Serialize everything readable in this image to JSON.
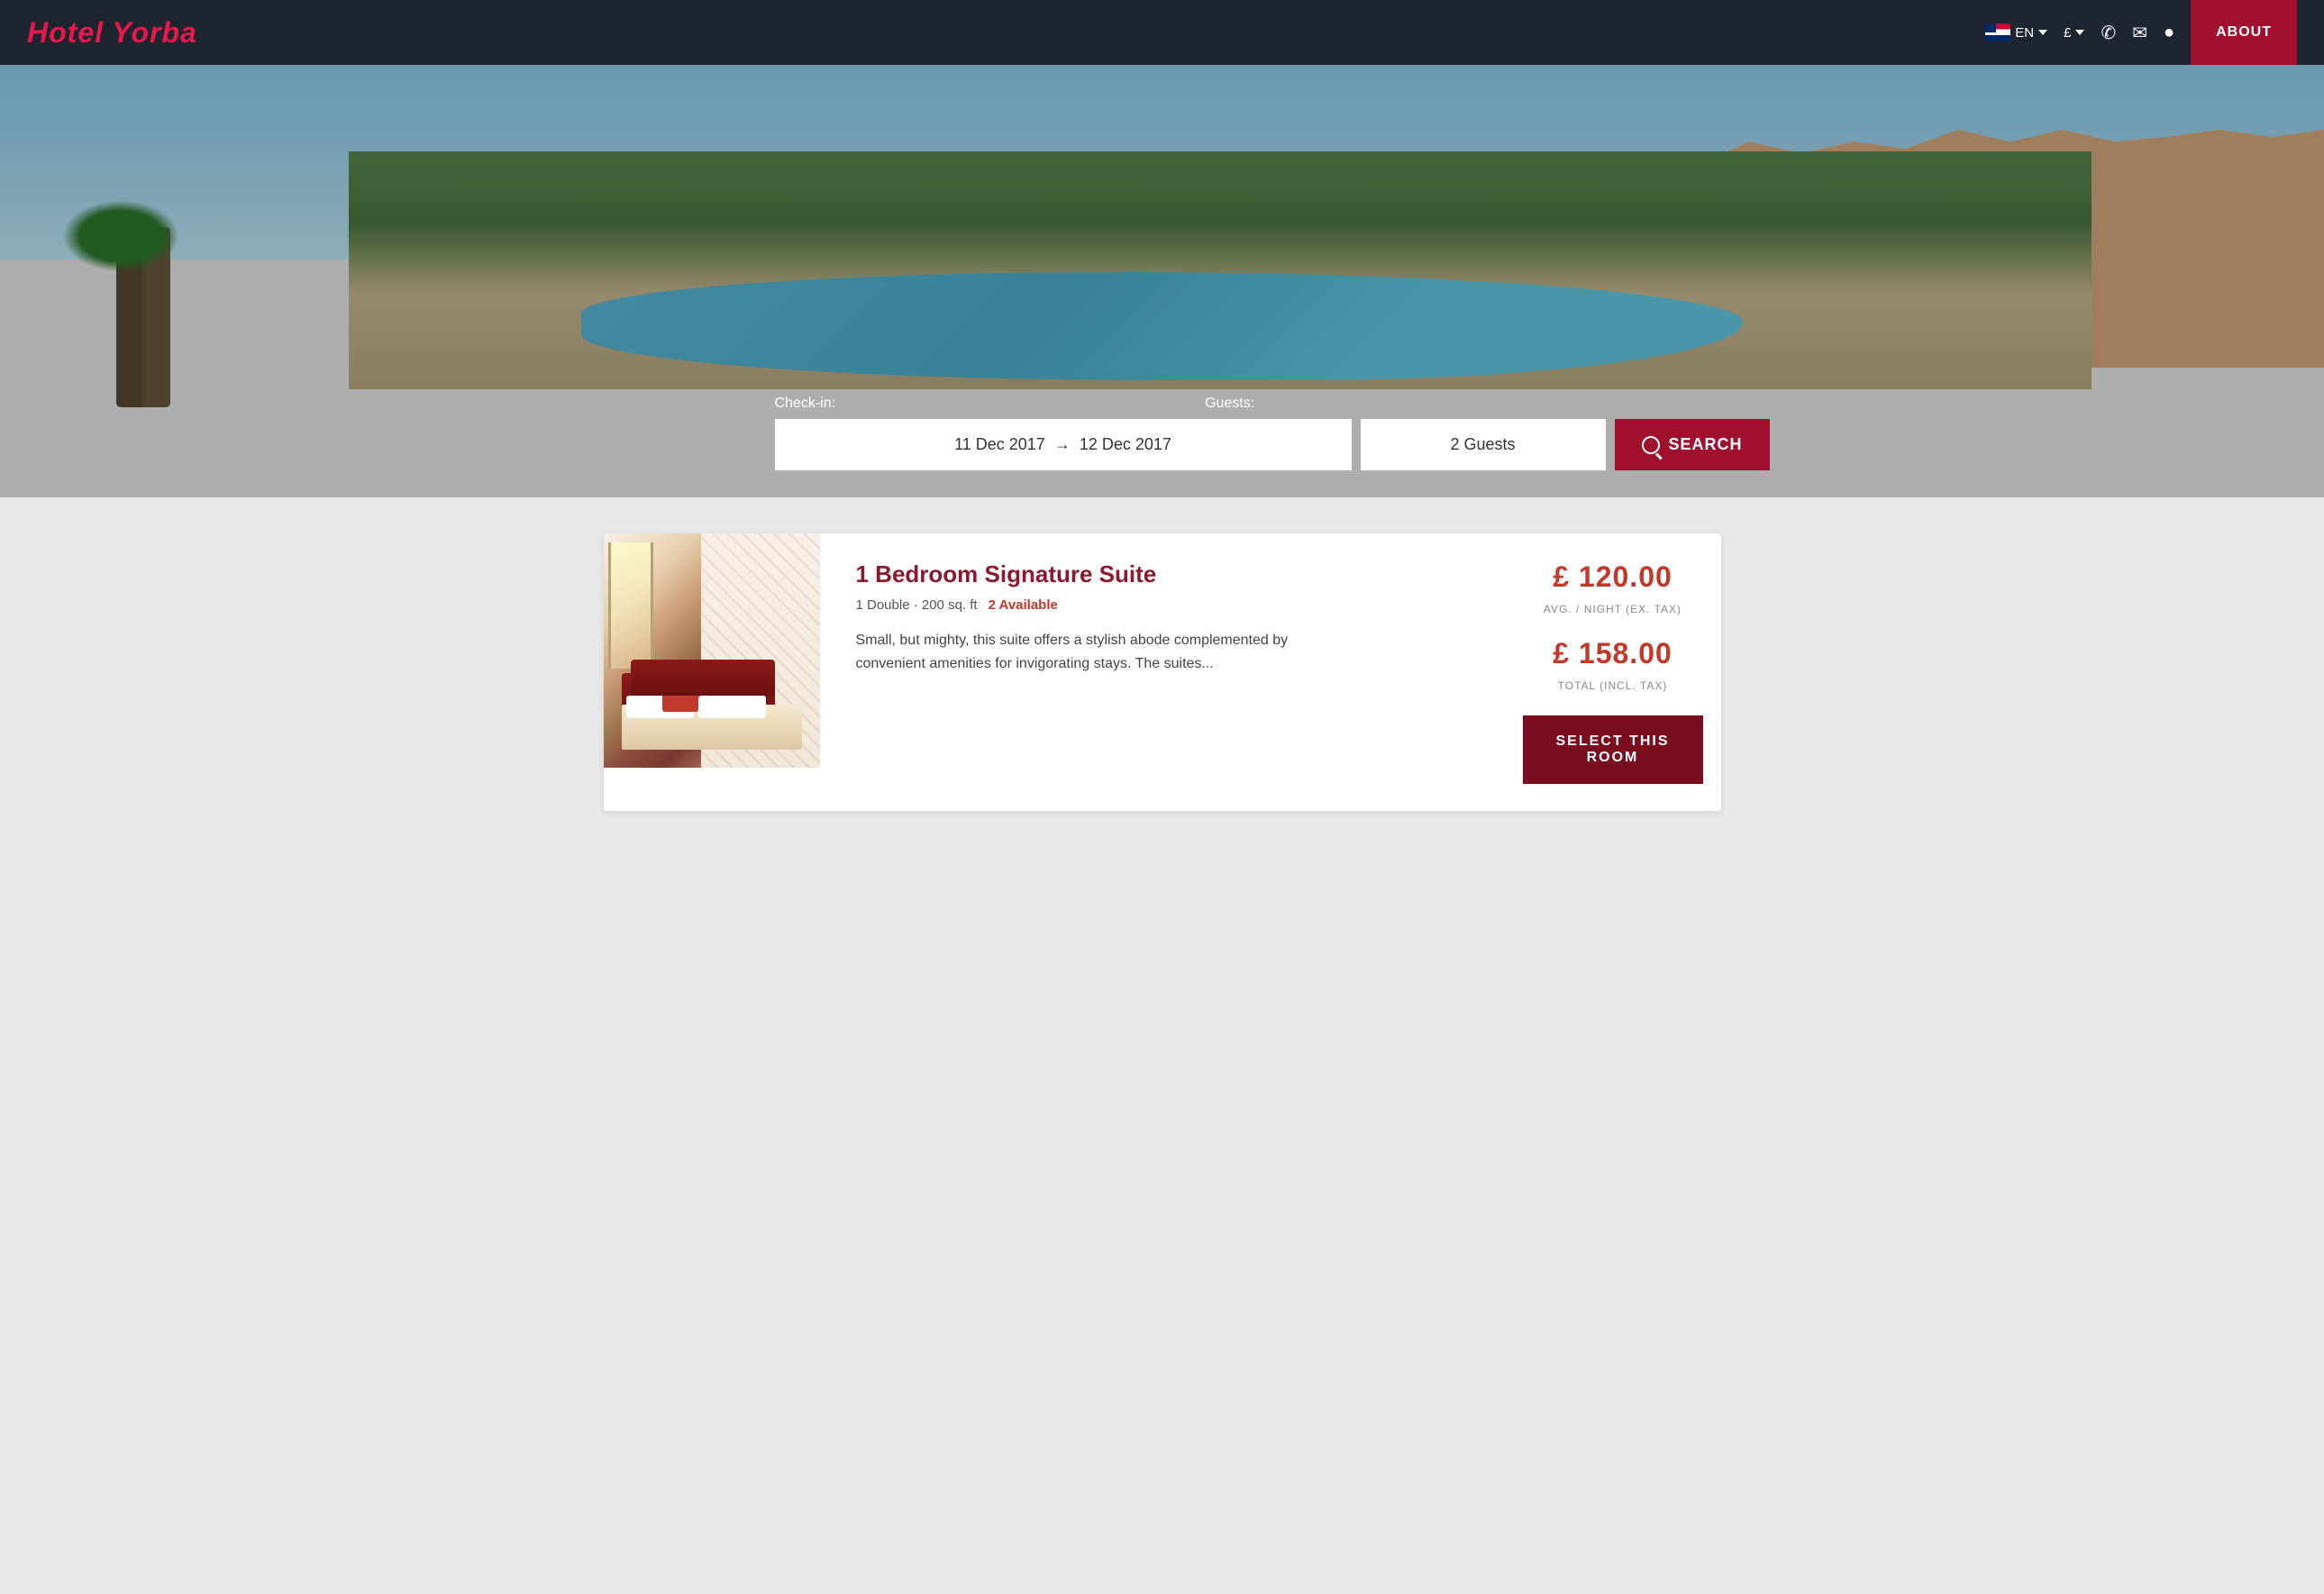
{
  "brand": {
    "name": "Hotel Yorba"
  },
  "navbar": {
    "lang_label": "EN",
    "currency_label": "£",
    "about_label": "ABOUT",
    "phone_icon": "phone-icon",
    "mail_icon": "mail-icon",
    "location_icon": "location-icon"
  },
  "hero": {
    "checkin_label": "Check-in:",
    "guests_label": "Guests:",
    "dates_value": "11 Dec 2017  →  12 Dec 2017",
    "guests_value": "2 Guests",
    "search_label": "SEARCH"
  },
  "room": {
    "title": "1 Bedroom Signature Suite",
    "meta": "1 Double · 200 sq. ft",
    "availability": "2 Available",
    "description": "Small, but mighty, this suite offers a stylish abode complemented by convenient amenities for invigorating stays. The suites...",
    "price_per_night": "£ 120.00",
    "price_per_night_label": "AVG. / NIGHT (EX. TAX)",
    "price_total": "£ 158.00",
    "price_total_label": "TOTAL (INCL. TAX)",
    "select_btn": "SELECT THIS ROOM"
  }
}
